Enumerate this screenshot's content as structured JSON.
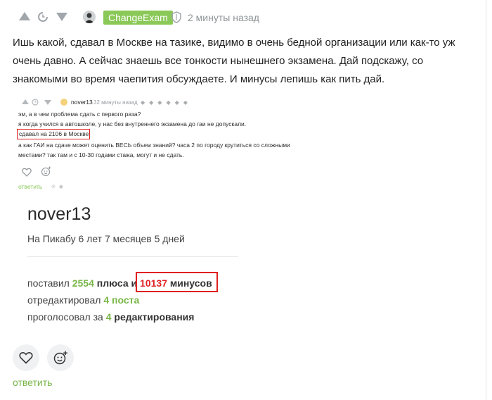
{
  "comment": {
    "author": "ChangeExam",
    "time": "2 минуты назад",
    "text": "Ишь какой, сдавал в Москве на тазике, видимо в очень бедной организации или как-то уж очень давно. А сейчас знаешь все тонкости нынешнего экзамена. Дай подскажу, со знакомыми во время чаепития обсуждаете. И минусы лепишь как пить дай.",
    "reply_label": "ответить",
    "icons": [
      "upvote-icon",
      "clock-icon",
      "downvote-icon",
      "shield-icon",
      "heart-icon",
      "emoji-add-icon"
    ]
  },
  "screenshot1": {
    "user": "nover13",
    "time": "32 минуты назад",
    "lines": [
      "эм, а в чем проблема сдать с первого раза?",
      "я когда учился в автошколе, у нас без внутреннего экзамена до гаи не допускали.",
      "сдавал на 2106 в Москве",
      "а как ГАИ на сдаче может оценить ВЕСЬ объем знаний? часа 2 по городу крутиться со сложными",
      "местами? так там и с 10-30 годами стажа, могут и не сдать."
    ],
    "reply_label": "ответить"
  },
  "screenshot2": {
    "username": "nover13",
    "since": "На Пикабу 6 лет 7 месяцев 5 дней",
    "plus_prefix": "поставил",
    "plus_count": "2554",
    "plus_mid": "плюса и",
    "minus_count": "10137",
    "minus_label": "минусов",
    "edited_prefix": "отредактировал",
    "edited_value": "4 поста",
    "voted_prefix": "проголосовал за",
    "voted_count": "4",
    "voted_label": "редактирования"
  }
}
